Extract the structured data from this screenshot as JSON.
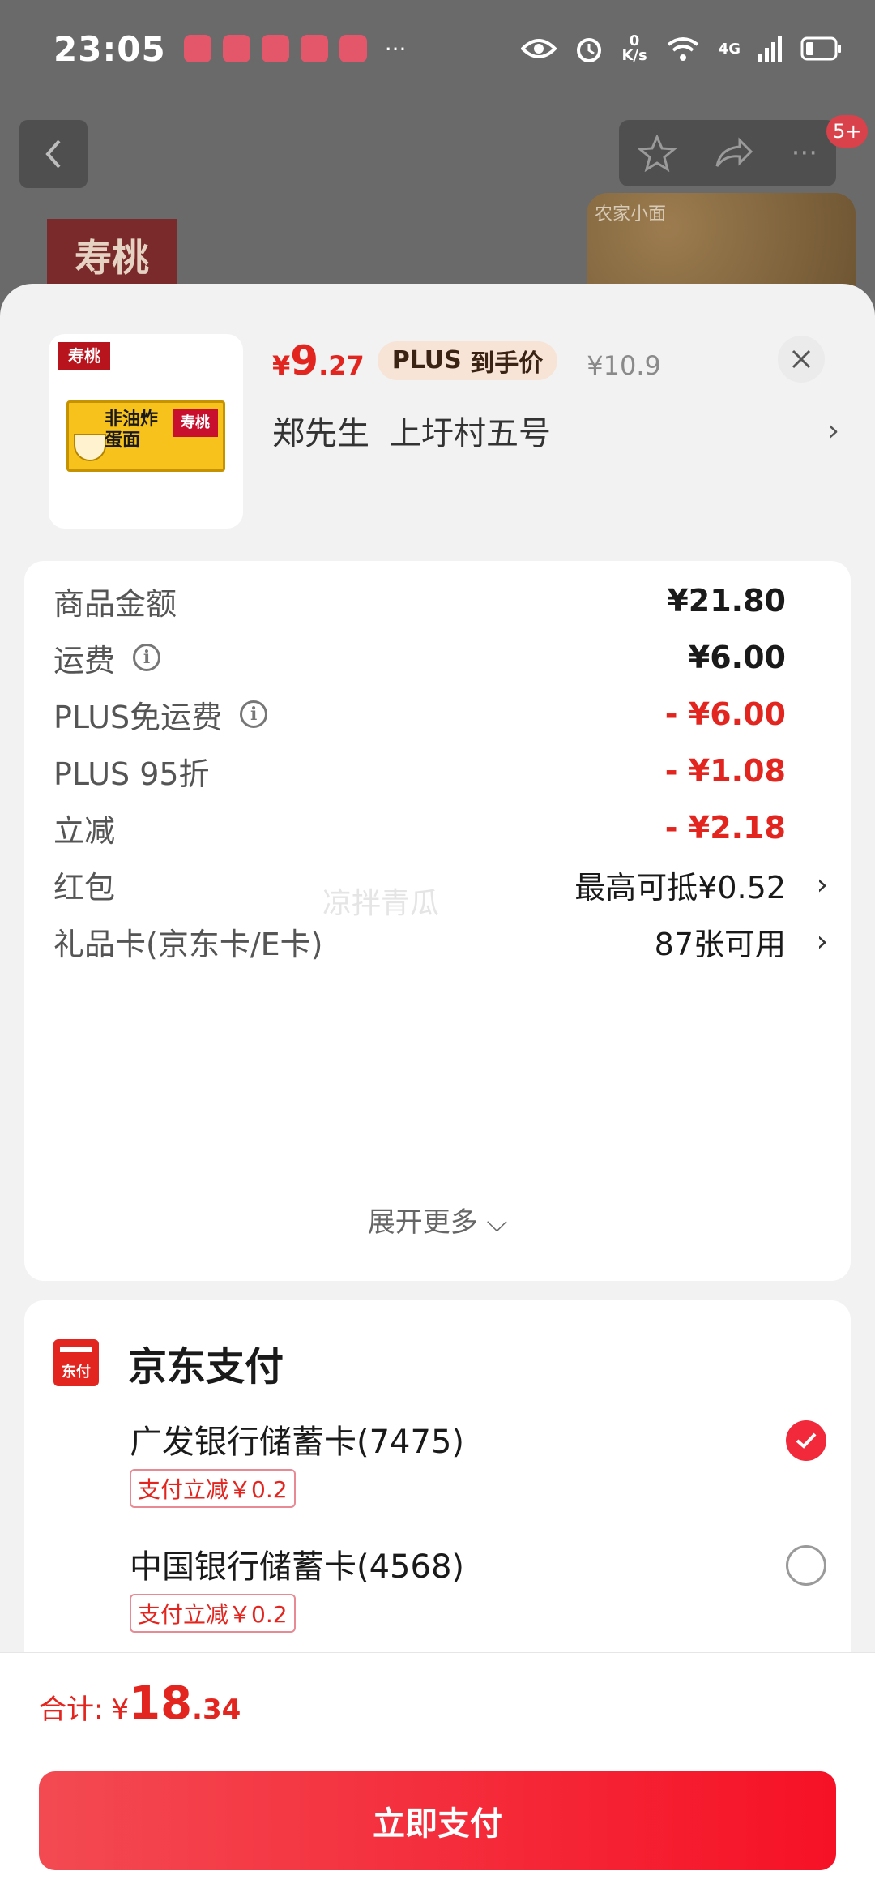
{
  "status_bar": {
    "time": "23:05",
    "net_speed_top": "0",
    "net_speed_unit": "K/s",
    "network": "4G"
  },
  "background": {
    "badge": "5+",
    "brand_logo": "寿桃",
    "wheat_label": "农家小面"
  },
  "product": {
    "logo": "寿桃",
    "box_text": "非油炸 蛋面",
    "box_brand": "寿桃",
    "price_yen": "¥",
    "price_int": "9",
    "price_dec": ".27",
    "plus_tag_plus": "PLUS",
    "plus_tag_text": "到手价",
    "original_price": "¥10.9"
  },
  "address": {
    "name": "郑先生",
    "detail": "上圩村五号",
    "chevron": "›"
  },
  "summary": {
    "lines": [
      {
        "label": "商品金额",
        "value": "¥21.80"
      },
      {
        "label": "运费",
        "value": "¥6.00"
      },
      {
        "label": "PLUS免运费",
        "value": "- ¥6.00"
      },
      {
        "label": "PLUS 95折",
        "value": "- ¥1.08"
      },
      {
        "label": "立减",
        "value": "- ¥2.18"
      },
      {
        "label": "红包",
        "value": "最高可抵¥0.52"
      },
      {
        "label": "礼品卡(京东卡/E卡)",
        "value": "87张可用"
      }
    ],
    "expand": "展开更多 ⌵",
    "watermark": "凉拌青瓜"
  },
  "payment": {
    "icon_text": "东付",
    "title": "京东支付",
    "banks": [
      {
        "name": "广发银行储蓄卡(7475)",
        "discount": "支付立减￥0.2",
        "selected": true
      },
      {
        "name": "中国银行储蓄卡(4568)",
        "discount": "支付立减￥0.2",
        "selected": false
      }
    ]
  },
  "footer": {
    "total_label": "合计:",
    "total_yen": "¥",
    "total_int": "18",
    "total_dec": ".34",
    "pay_button": "立即支付"
  },
  "colors": {
    "accent_red": "#e3251f",
    "button_red": "#f61126"
  }
}
